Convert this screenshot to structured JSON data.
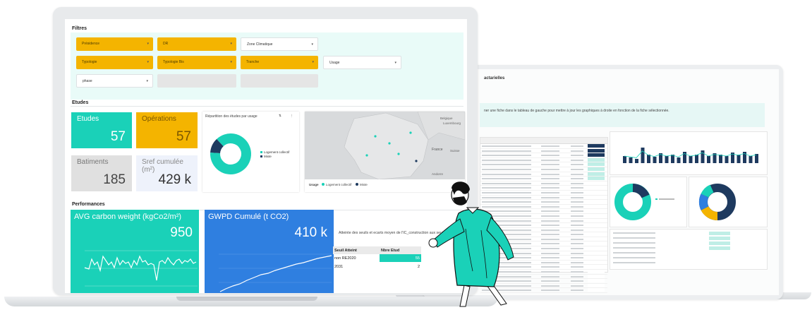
{
  "colors": {
    "teal": "#1ad1b8",
    "amber": "#f4b400",
    "blue": "#2f7fe0",
    "navy": "#1e3a5f"
  },
  "filters": {
    "title": "Filtres",
    "dropdowns": [
      {
        "label": "Présidence",
        "style": "amber"
      },
      {
        "label": "DR",
        "style": "amber"
      },
      {
        "label": "Zone Climatique",
        "style": "white"
      },
      {
        "label": "Typologie",
        "style": "amber"
      },
      {
        "label": "Typologie Bis",
        "style": "amber"
      },
      {
        "label": "Tranche",
        "style": "amber"
      },
      {
        "label": "Usage",
        "style": "white"
      },
      {
        "label": "phase",
        "style": "white"
      }
    ]
  },
  "etudes": {
    "title": "Etudes",
    "cards": [
      {
        "label": "Etudes",
        "value": "57"
      },
      {
        "label": "Opérations",
        "value": "57"
      },
      {
        "label": "Batiments",
        "value": "185"
      },
      {
        "label": "Sref cumulée (m²)",
        "value": "429 k"
      }
    ],
    "donut": {
      "title": "Répartition des études par usage",
      "legend": [
        "Logement collectif",
        "Mixte"
      ],
      "values": [
        88,
        12
      ]
    },
    "map": {
      "labels": [
        "Belgique",
        "Luxembourg",
        "France",
        "Suisse",
        "Andorre"
      ],
      "legend_title": "Usage",
      "legend": [
        "Logement collectif",
        "Mixte"
      ]
    }
  },
  "performances": {
    "title": "Performances",
    "avg": {
      "label": "AVG carbon weight (kgCo2/m²)",
      "value": "950"
    },
    "gwpd": {
      "label": "GWPD Cumulé (t CO2)",
      "value": "410 k"
    },
    "seuils": {
      "title": "Atteinte des seuils et ecarts moyen de l'IC_construction aux seu",
      "headers": [
        "Seuil Atteint",
        "Nbre Etud"
      ],
      "rows": [
        {
          "seuil": "non RE2020",
          "nb": "55"
        },
        {
          "seuil": "2031",
          "nb": "2"
        }
      ]
    }
  },
  "back_dashboard": {
    "title": "actarielles",
    "hint": "ner une fiche dans le tableau de gauche pour mettre à jour les graphiques à droite en fonction de la fiche sélectionnée."
  }
}
